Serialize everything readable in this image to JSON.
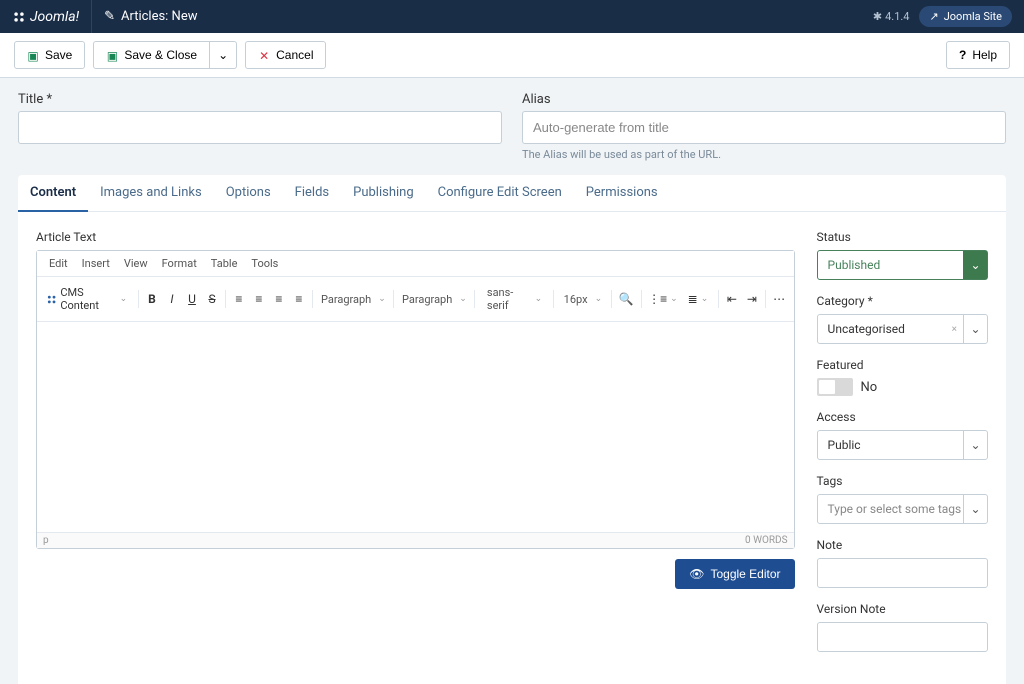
{
  "topbar": {
    "brand": "Joomla!",
    "page": "Articles: New",
    "version": "4.1.4",
    "site_btn": "Joomla Site"
  },
  "toolbar": {
    "save": "Save",
    "save_close": "Save & Close",
    "cancel": "Cancel",
    "help": "Help"
  },
  "fields": {
    "title_label": "Title",
    "alias_label": "Alias",
    "alias_placeholder": "Auto-generate from title",
    "alias_hint": "The Alias will be used as part of the URL."
  },
  "tabs": [
    "Content",
    "Images and Links",
    "Options",
    "Fields",
    "Publishing",
    "Configure Edit Screen",
    "Permissions"
  ],
  "editor": {
    "label": "Article Text",
    "menu": [
      "Edit",
      "Insert",
      "View",
      "Format",
      "Table",
      "Tools"
    ],
    "cms_btn": "CMS Content",
    "sel_block": "Paragraph",
    "sel_style": "Paragraph",
    "sel_font": "sans-serif",
    "sel_size": "16px",
    "path": "p",
    "words": "0 WORDS",
    "toggle": "Toggle Editor"
  },
  "side": {
    "status": {
      "label": "Status",
      "value": "Published"
    },
    "category": {
      "label": "Category",
      "value": "Uncategorised"
    },
    "featured": {
      "label": "Featured",
      "value": "No"
    },
    "access": {
      "label": "Access",
      "value": "Public"
    },
    "tags": {
      "label": "Tags",
      "placeholder": "Type or select some tags"
    },
    "note": {
      "label": "Note"
    },
    "version_note": {
      "label": "Version Note"
    }
  }
}
